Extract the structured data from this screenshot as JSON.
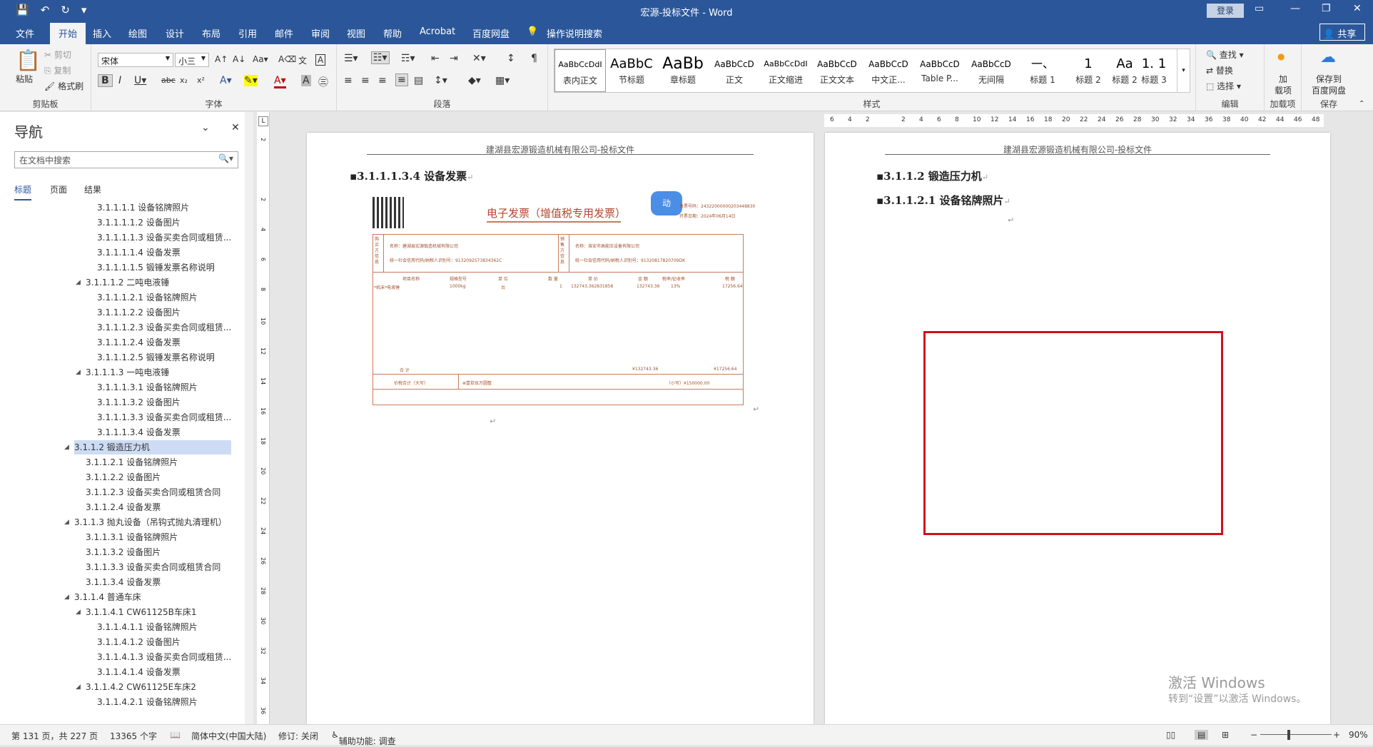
{
  "window": {
    "title": "宏源-投标文件 - Word",
    "login": "登录",
    "share": "共享"
  },
  "tabs": [
    "文件",
    "开始",
    "插入",
    "绘图",
    "设计",
    "布局",
    "引用",
    "邮件",
    "审阅",
    "视图",
    "帮助",
    "Acrobat",
    "百度网盘"
  ],
  "tell_me": "操作说明搜索",
  "ribbon": {
    "clipboard": {
      "paste": "粘贴",
      "cut": "剪切",
      "copy": "复制",
      "format_painter": "格式刷",
      "label": "剪贴板"
    },
    "font": {
      "name": "宋体",
      "size": "小三",
      "label": "字体"
    },
    "paragraph": {
      "label": "段落"
    },
    "styles": {
      "label": "样式",
      "items": [
        {
          "preview": "AaBbCcDdI",
          "name": "表内正文"
        },
        {
          "preview": "AaBbC",
          "name": "节标题"
        },
        {
          "preview": "AaBb",
          "name": "章标题"
        },
        {
          "preview": "AaBbCcD",
          "name": "正文"
        },
        {
          "preview": "AaBbCcDdI",
          "name": "正文缩进"
        },
        {
          "preview": "AaBbCcD",
          "name": "正文文本"
        },
        {
          "preview": "AaBbCcD",
          "name": "中文正..."
        },
        {
          "preview": "AaBbCcD",
          "name": "Table P..."
        },
        {
          "preview": "AaBbCcD",
          "name": "无间隔"
        },
        {
          "preview": "一、",
          "name": "标题 1"
        },
        {
          "preview": "1",
          "name": "标题 2"
        },
        {
          "preview": "Aa",
          "name": "标题 2"
        },
        {
          "preview": "1. 1",
          "name": "标题 3"
        }
      ]
    },
    "editing": {
      "find": "查找",
      "replace": "替换",
      "select": "选择",
      "label": "编辑"
    },
    "addins": {
      "btn": "加载项",
      "btn_line1": "加",
      "btn_line2": "载项",
      "label": "加载项"
    },
    "save": {
      "btn_line1": "保存到",
      "btn_line2": "百度网盘",
      "label": "保存"
    }
  },
  "nav": {
    "title": "导航",
    "search_placeholder": "在文档中搜索",
    "tabs": [
      "标题",
      "页面",
      "结果"
    ],
    "items": [
      {
        "text": "3.1.1.1.1 设备铭牌照片",
        "level": 3
      },
      {
        "text": "3.1.1.1.1.2 设备图片",
        "level": 3
      },
      {
        "text": "3.1.1.1.1.3 设备买卖合同或租赁...",
        "level": 3
      },
      {
        "text": "3.1.1.1.1.4 设备发票",
        "level": 3
      },
      {
        "text": "3.1.1.1.1.5 锻锤发票名称说明",
        "level": 3
      },
      {
        "text": "3.1.1.1.2 二吨电液锤",
        "level": 2,
        "caret": true
      },
      {
        "text": "3.1.1.1.2.1 设备铭牌照片",
        "level": 3
      },
      {
        "text": "3.1.1.1.2.2 设备图片",
        "level": 3
      },
      {
        "text": "3.1.1.1.2.3 设备买卖合同或租赁...",
        "level": 3
      },
      {
        "text": "3.1.1.1.2.4 设备发票",
        "level": 3
      },
      {
        "text": "3.1.1.1.2.5 锻锤发票名称说明",
        "level": 3
      },
      {
        "text": "3.1.1.1.3 一吨电液锤",
        "level": 2,
        "caret": true
      },
      {
        "text": "3.1.1.1.3.1 设备铭牌照片",
        "level": 3
      },
      {
        "text": "3.1.1.1.3.2 设备图片",
        "level": 3
      },
      {
        "text": "3.1.1.1.3.3 设备买卖合同或租赁...",
        "level": 3
      },
      {
        "text": "3.1.1.1.3.4 设备发票",
        "level": 3
      },
      {
        "text": "3.1.1.2 锻造压力机",
        "level": 1,
        "caret": true,
        "selected": true
      },
      {
        "text": "3.1.1.2.1 设备铭牌照片",
        "level": 2
      },
      {
        "text": "3.1.1.2.2 设备图片",
        "level": 2
      },
      {
        "text": "3.1.1.2.3 设备买卖合同或租赁合同",
        "level": 2
      },
      {
        "text": "3.1.1.2.4 设备发票",
        "level": 2
      },
      {
        "text": "3.1.1.3 抛丸设备（吊钩式抛丸清理机）",
        "level": 1,
        "caret": true
      },
      {
        "text": "3.1.1.3.1 设备铭牌照片",
        "level": 2
      },
      {
        "text": "3.1.1.3.2 设备图片",
        "level": 2
      },
      {
        "text": "3.1.1.3.3 设备买卖合同或租赁合同",
        "level": 2
      },
      {
        "text": "3.1.1.3.4 设备发票",
        "level": 2
      },
      {
        "text": "3.1.1.4 普通车床",
        "level": 1,
        "caret": true
      },
      {
        "text": "3.1.1.4.1 CW61125B车床1",
        "level": 2,
        "caret": true
      },
      {
        "text": "3.1.1.4.1.1 设备铭牌照片",
        "level": 3
      },
      {
        "text": "3.1.1.4.1.2 设备图片",
        "level": 3
      },
      {
        "text": "3.1.1.4.1.3 设备买卖合同或租赁...",
        "level": 3
      },
      {
        "text": "3.1.1.4.1.4 设备发票",
        "level": 3
      },
      {
        "text": "3.1.1.4.2 CW61125E车床2",
        "level": 2,
        "caret": true
      },
      {
        "text": "3.1.1.4.2.1 设备铭牌照片",
        "level": 3
      }
    ]
  },
  "doc": {
    "header": "建湖县宏源锻造机械有限公司-投标文件",
    "left_heading": "3.1.1.1.3.4 设备发票",
    "right_heading1": "3.1.1.2  锻造压力机",
    "right_heading2": "3.1.1.2.1    设备铭牌照片",
    "invoice": {
      "title": "电子发票（增值税专用发票）",
      "number_label": "发票号码：",
      "number": "24322000000203448830",
      "date_label": "开票日期：",
      "date": "2024年06月14日",
      "buyer_label": "购买方信息",
      "buyer_name": "名称：建湖县宏源锻造机械有限公司",
      "buyer_tax": "统一社会信用代码/纳税人识别号：9132092573834362C",
      "seller_label": "销售方信息",
      "seller_name": "名称：淮安市高能压设备有限公司",
      "seller_tax": "统一社会信用代码/纳税人识别号：91320817820709DK",
      "cols": [
        "项目名称",
        "规格型号",
        "单 位",
        "数 量",
        "单 价",
        "金 额",
        "税率/征收率",
        "税 额"
      ],
      "row": [
        "*机床*电液锤",
        "1000kg",
        "台",
        "1",
        "132743.362831858",
        "132743.36",
        "13%",
        "17256.64"
      ],
      "total_label": "合  计",
      "total_amount": "¥132743.36",
      "total_tax": "¥17256.64",
      "grand_label": "价税合计（大写）",
      "grand_words": "⊗壹拾伍万圆整",
      "grand_small": "（小写）¥150000.00"
    }
  },
  "ruler_ticks": [
    "6",
    "4",
    "2",
    "",
    "2",
    "4",
    "6",
    "8",
    "10",
    "12",
    "14",
    "16",
    "18",
    "20",
    "22",
    "24",
    "26",
    "28",
    "30",
    "32",
    "34",
    "36",
    "38",
    "40",
    "42",
    "44",
    "46",
    "48"
  ],
  "vruler_ticks": [
    "2",
    "",
    "2",
    "4",
    "6",
    "8",
    "10",
    "12",
    "14",
    "16",
    "18",
    "20",
    "22",
    "24",
    "26",
    "28",
    "30",
    "32",
    "34",
    "36",
    "38"
  ],
  "status": {
    "page": "第 131 页，共 227 页",
    "words": "13365 个字",
    "lang": "简体中文(中国大陆)",
    "track": "修订: 关闭",
    "access": "辅助功能: 调查",
    "zoom": "90%"
  },
  "watermark": {
    "line1": "激活 Windows",
    "line2": "转到“设置”以激活 Windows。"
  },
  "colors": {
    "brand": "#2b579a",
    "highlight_box": "#d0101d",
    "invoice": "#a0522d"
  }
}
